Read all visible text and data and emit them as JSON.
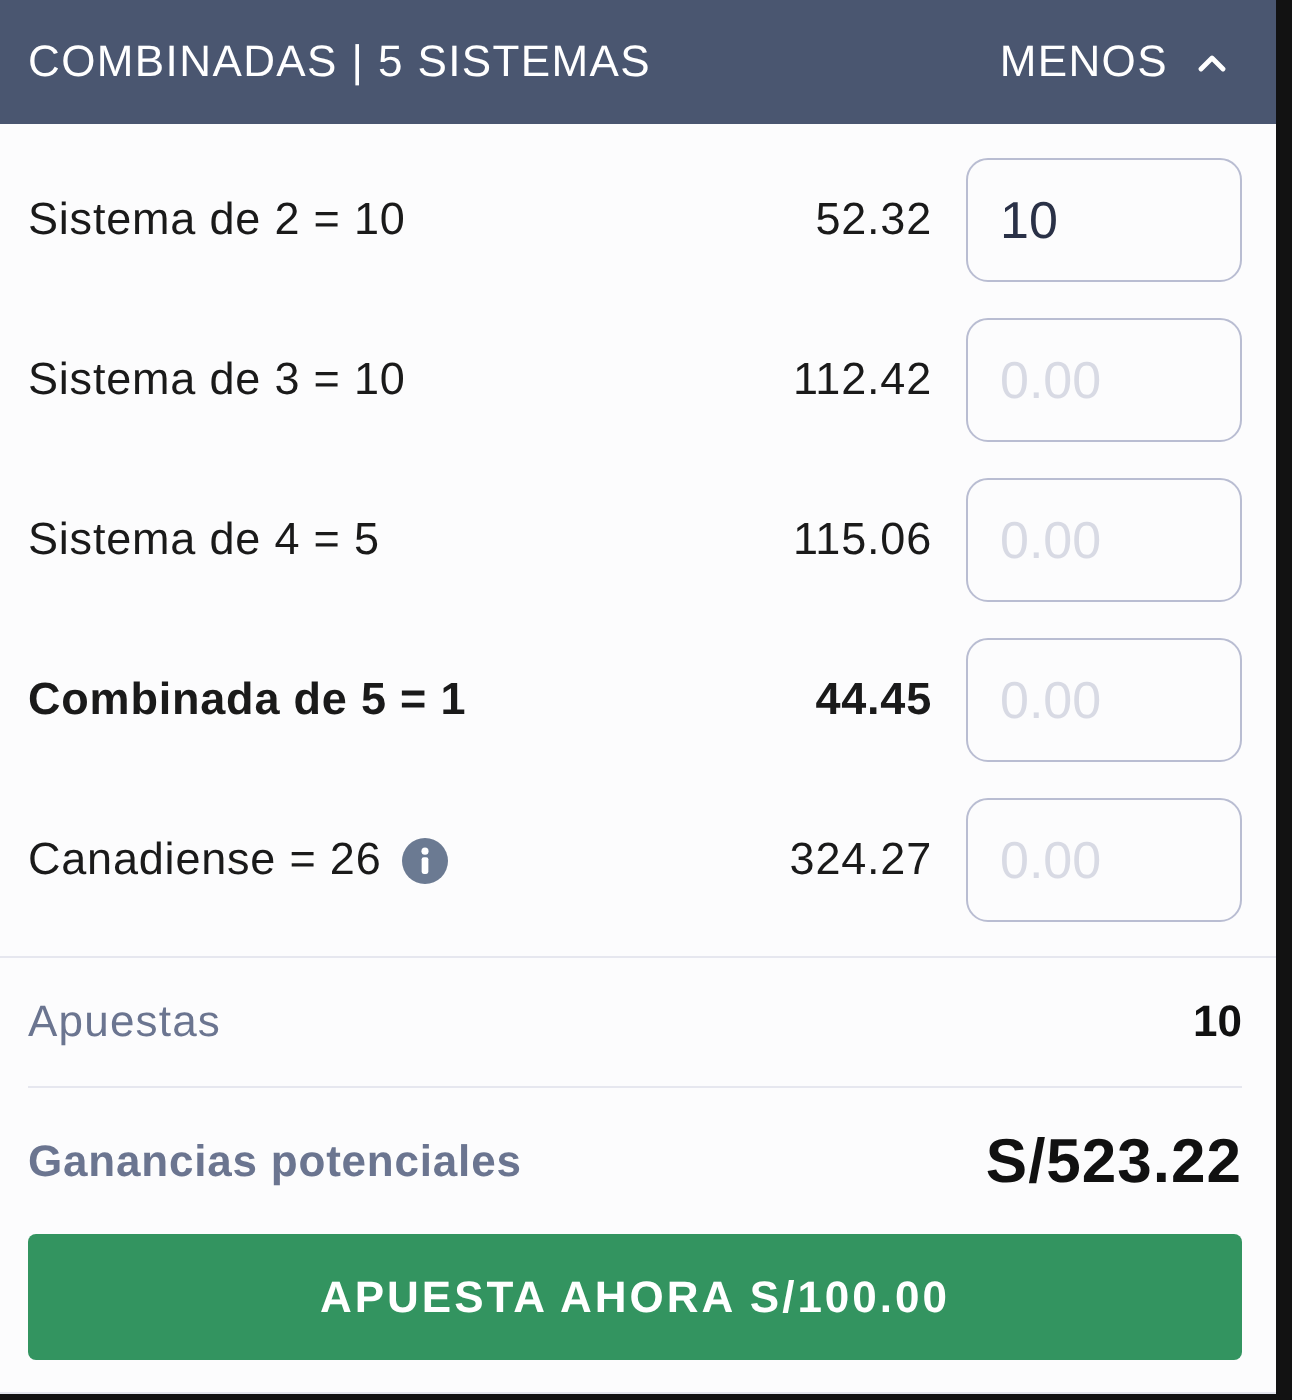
{
  "header": {
    "title": "COMBINADAS | 5 SISTEMAS",
    "toggle": {
      "label": "MENOS",
      "expanded": true
    }
  },
  "systems": [
    {
      "name": "Sistema de 2 = 10",
      "odds": "52.32",
      "highlighted": false,
      "info": false,
      "stake": {
        "value": "10"
      }
    },
    {
      "name": "Sistema de 3 = 10",
      "odds": "112.42",
      "highlighted": false,
      "info": false,
      "stake": {
        "placeholder": "0.00"
      }
    },
    {
      "name": "Sistema de 4 = 5",
      "odds": "115.06",
      "highlighted": false,
      "info": false,
      "stake": {
        "placeholder": "0.00"
      }
    },
    {
      "name": "Combinada de 5 = 1",
      "odds": "44.45",
      "highlighted": true,
      "info": false,
      "stake": {
        "placeholder": "0.00"
      }
    },
    {
      "name": "Canadiense = 26",
      "odds": "324.27",
      "highlighted": false,
      "info": true,
      "stake": {
        "placeholder": "0.00"
      }
    }
  ],
  "summary": {
    "bets": {
      "label": "Apuestas",
      "value": "10"
    },
    "winnings": {
      "label": "Ganancias potenciales",
      "value": "S/523.22"
    }
  },
  "action": {
    "label": "APUESTA AHORA S/100.00"
  }
}
